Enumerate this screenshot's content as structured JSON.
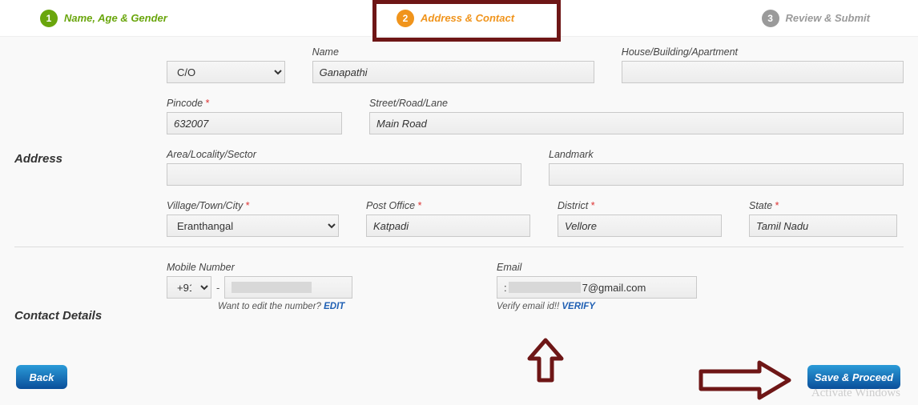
{
  "stepper": {
    "step1": {
      "num": "1",
      "label": "Name, Age & Gender"
    },
    "step2": {
      "num": "2",
      "label": "Address & Contact"
    },
    "step3": {
      "num": "3",
      "label": "Review & Submit"
    }
  },
  "sections": {
    "address": "Address",
    "contact": "Contact Details"
  },
  "fields": {
    "co_select": "C/O",
    "name_label": "Name",
    "name_value": "Ganapathi",
    "house_label": "House/Building/Apartment",
    "house_value": "",
    "pincode_label": "Pincode",
    "pincode_value": "632007",
    "street_label": "Street/Road/Lane",
    "street_value": "Main Road",
    "area_label": "Area/Locality/Sector",
    "area_value": "",
    "landmark_label": "Landmark",
    "landmark_value": "",
    "village_label": "Village/Town/City",
    "village_value": "Eranthangal",
    "po_label": "Post Office",
    "po_value": "Katpadi",
    "district_label": "District",
    "district_value": "Vellore",
    "state_label": "State",
    "state_value": "Tamil Nadu",
    "mobile_label": "Mobile Number",
    "mobile_dial": "+91",
    "mobile_sep": "-",
    "mobile_hint_prefix": "Want to edit the number? ",
    "mobile_hint_link": "EDIT",
    "email_label": "Email",
    "email_suffix": "7@gmail.com",
    "email_hint_prefix": "Verify email id!! ",
    "email_hint_link": "VERIFY"
  },
  "buttons": {
    "back": "Back",
    "next": "Save & Proceed"
  },
  "watermark": "Activate Windows",
  "required_mark": "*"
}
